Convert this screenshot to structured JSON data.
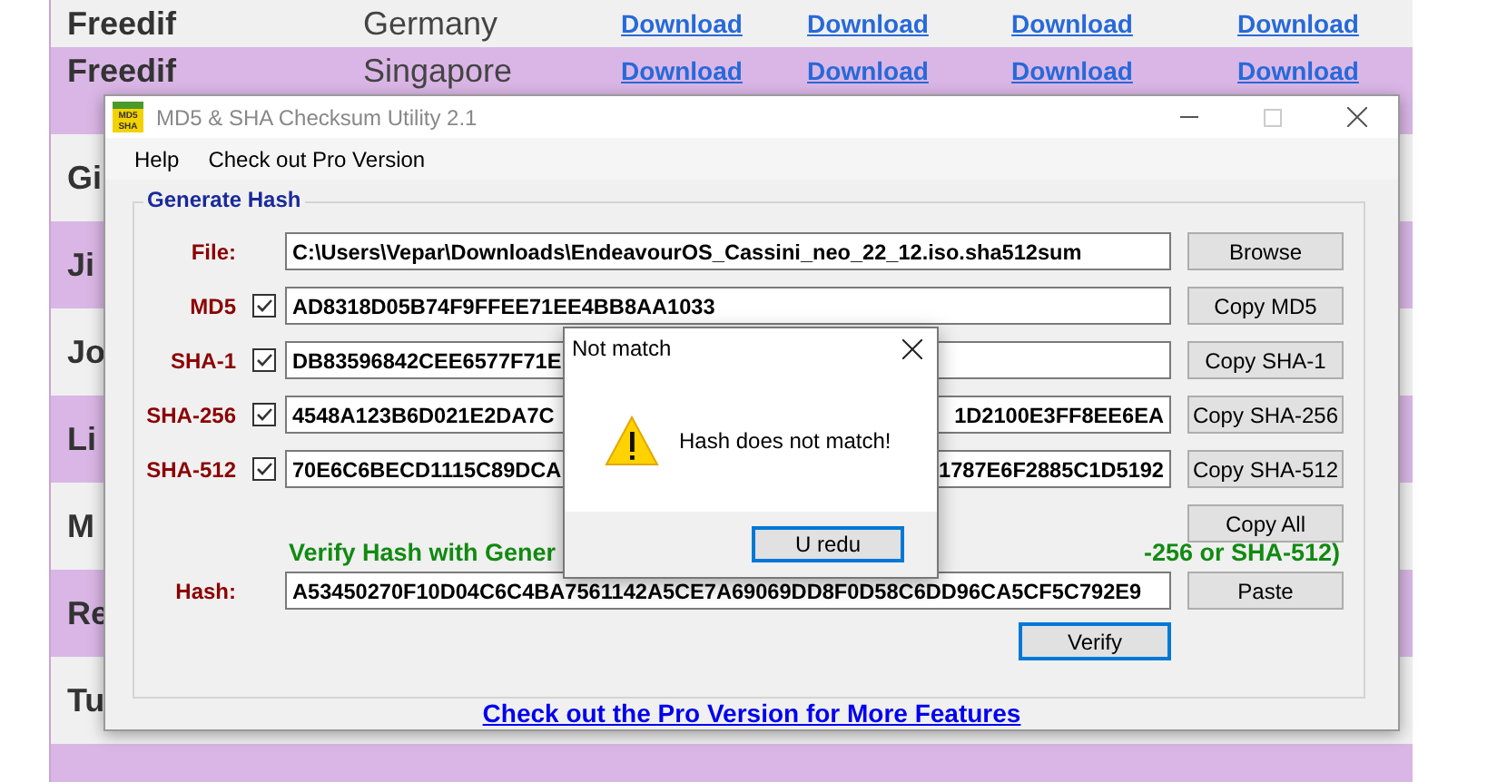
{
  "background_table": {
    "rows": [
      {
        "cells": [
          "Freedif",
          "Germany",
          "Download",
          "Download",
          "Download",
          "Download"
        ]
      },
      {
        "cells": [
          "Freedif",
          "Singapore",
          "Download",
          "Download",
          "Download",
          "Download"
        ]
      },
      {
        "cells": [
          "Gi"
        ]
      },
      {
        "cells": [
          "Ji"
        ]
      },
      {
        "cells": [
          "Jo"
        ]
      },
      {
        "cells": [
          "Li"
        ]
      },
      {
        "cells": [
          "M"
        ]
      },
      {
        "cells": [
          "Re"
        ]
      },
      {
        "cells": [
          "Tu"
        ]
      }
    ]
  },
  "window": {
    "title": "MD5 & SHA Checksum Utility 2.1",
    "app_icon": [
      "MD5",
      "SHA"
    ],
    "maximize_disabled": true
  },
  "menu": [
    "Help",
    "Check out Pro Version"
  ],
  "group": {
    "title": "Generate Hash",
    "file": {
      "label": "File:",
      "value": "C:\\Users\\Vepar\\Downloads\\EndeavourOS_Cassini_neo_22_12.iso.sha512sum",
      "button": "Browse"
    },
    "hashes": [
      {
        "label": "MD5",
        "checked": true,
        "value_left": "AD8318D05B74F9FFEE71EE4BB8AA1033",
        "button": "Copy MD5"
      },
      {
        "label": "SHA-1",
        "checked": true,
        "value_left": "DB83596842CEE6577F71E",
        "button": "Copy SHA-1"
      },
      {
        "label": "SHA-256",
        "checked": true,
        "value_left": "4548A123B6D021E2DA7C",
        "value_right": "1D2100E3FF8EE6EA",
        "button": "Copy SHA-256"
      },
      {
        "label": "SHA-512",
        "checked": true,
        "value_left": "70E6C6BECD1115C89DCA",
        "value_right": "1787E6F2885C1D5192",
        "button": "Copy SHA-512"
      }
    ],
    "copy_all": "Copy All",
    "verify_heading_left": "Verify Hash with Gener",
    "verify_heading_right": "-256 or SHA-512)",
    "hash": {
      "label": "Hash:",
      "value": "A53450270F10D04C6C4BA7561142A5CE7A69069DD8F0D58C6DD96CA5CF5C792E9",
      "button": "Paste"
    },
    "verify_button": "Verify"
  },
  "pro_link": "Check out the Pro Version for More Features",
  "dialog": {
    "title": "Not match",
    "message": "Hash does not match!",
    "button": "U redu"
  }
}
